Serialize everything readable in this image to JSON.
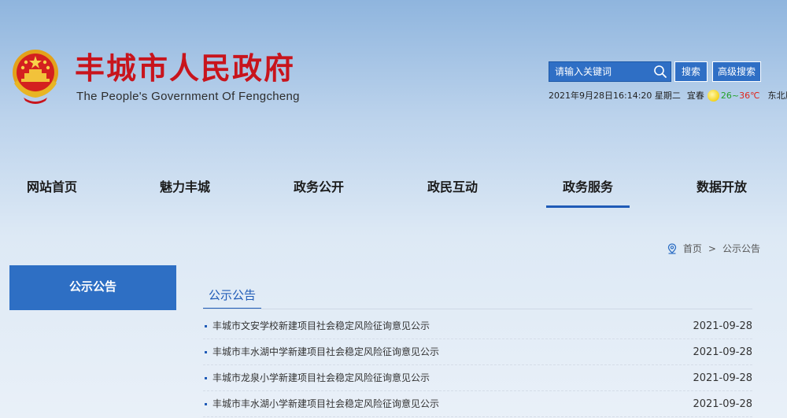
{
  "header": {
    "title_cn": "丰城市人民政府",
    "title_en": "The People's Government Of Fengcheng",
    "search": {
      "placeholder": "请输入关键词",
      "search_label": "搜索",
      "advanced_label": "高级搜索"
    },
    "info": {
      "datetime": "2021年9月28日16:14:20 星期二",
      "city": "宜春",
      "weather_icon": "sun-icon",
      "temp_low": "26",
      "temp_sep": "~",
      "temp_high": "36℃",
      "wind": "东北风",
      "more": "»"
    }
  },
  "nav": {
    "items": [
      {
        "label": "网站首页"
      },
      {
        "label": "魅力丰城"
      },
      {
        "label": "政务公开"
      },
      {
        "label": "政民互动"
      },
      {
        "label": "政务服务",
        "active": true
      },
      {
        "label": "数据开放"
      }
    ]
  },
  "breadcrumb": {
    "home": "首页",
    "separator": ">",
    "current": "公示公告"
  },
  "sidebar": {
    "active_tab": "公示公告"
  },
  "content": {
    "section_title": "公示公告",
    "items": [
      {
        "title": "丰城市文安学校新建项目社会稳定风险征询意见公示",
        "date": "2021-09-28"
      },
      {
        "title": "丰城市丰水湖中学新建项目社会稳定风险征询意见公示",
        "date": "2021-09-28"
      },
      {
        "title": "丰城市龙泉小学新建项目社会稳定风险征询意见公示",
        "date": "2021-09-28"
      },
      {
        "title": "丰城市丰水湖小学新建项目社会稳定风险征询意见公示",
        "date": "2021-09-28"
      }
    ]
  },
  "colors": {
    "title_red": "#c8141c",
    "primary_blue": "#2e6fc4",
    "active_underline": "#1f5bb7"
  }
}
